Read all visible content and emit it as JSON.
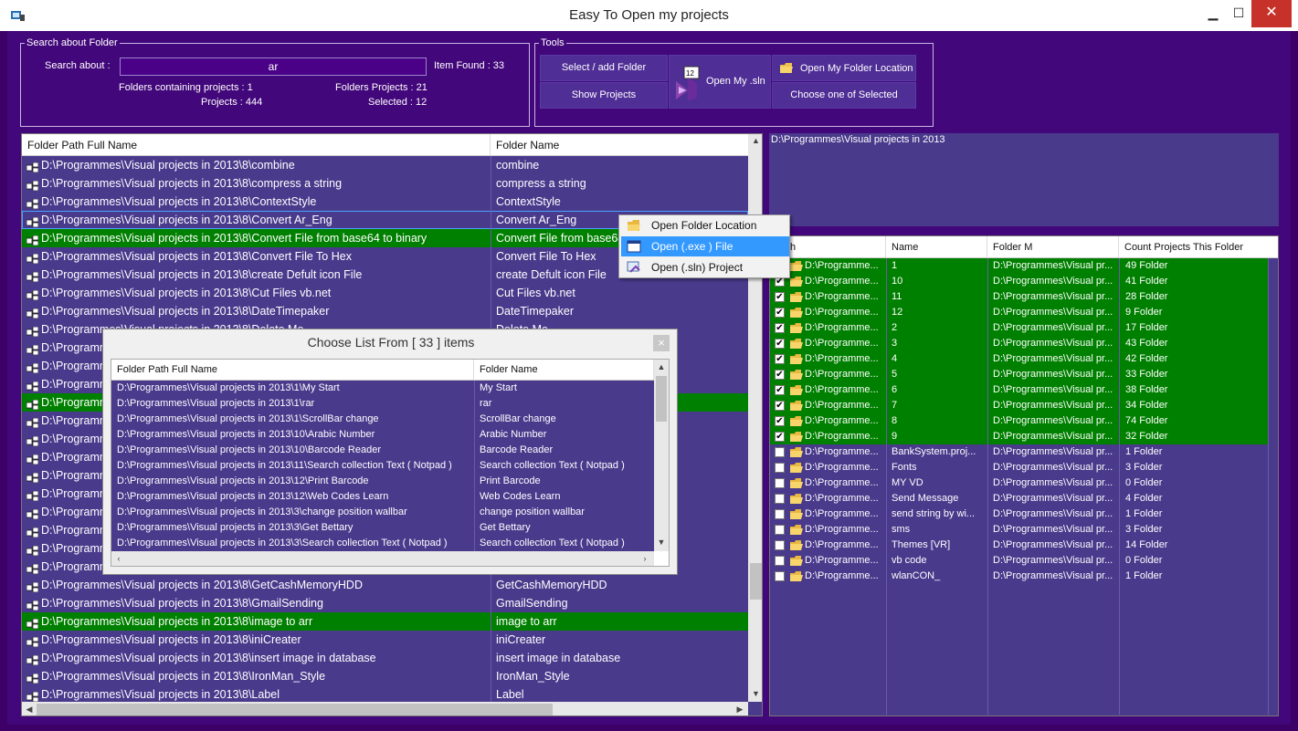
{
  "window": {
    "title": "Easy To Open my projects",
    "minimize": "▁",
    "maximize": "☐",
    "close": "✕"
  },
  "search": {
    "legend": "Search about Folder",
    "label": "Search about :",
    "value": "ar",
    "item_found": "Item Found : 33",
    "folders_containing": "Folders containing projects : 1",
    "folders_projects": "Folders Projects :  21",
    "projects": "Projects : 444",
    "selected": "Selected :  12"
  },
  "tools": {
    "legend": "Tools",
    "select_add": "Select / add Folder",
    "show_projects": "Show Projects",
    "open_sln": "Open My .sln",
    "open_folder_location": "Open My Folder Location",
    "choose_selected": "Choose one of Selected",
    "sln_badge": "12"
  },
  "main_grid": {
    "columns": [
      "Folder Path Full Name",
      "Folder Name"
    ],
    "rows": [
      {
        "path": "D:\\Programmes\\Visual projects in 2013\\8\\combine",
        "name": "combine",
        "state": "normal"
      },
      {
        "path": "D:\\Programmes\\Visual projects in 2013\\8\\compress a string",
        "name": "compress a string",
        "state": "normal"
      },
      {
        "path": "D:\\Programmes\\Visual projects in 2013\\8\\ContextStyle",
        "name": "ContextStyle",
        "state": "normal"
      },
      {
        "path": "D:\\Programmes\\Visual projects in 2013\\8\\Convert Ar_Eng",
        "name": "Convert Ar_Eng",
        "state": "selected"
      },
      {
        "path": "D:\\Programmes\\Visual projects in 2013\\8\\Convert File from base64 to binary",
        "name": "Convert File from base64 to binary",
        "state": "green"
      },
      {
        "path": "D:\\Programmes\\Visual projects in 2013\\8\\Convert File To Hex",
        "name": "Convert File To Hex",
        "state": "normal"
      },
      {
        "path": "D:\\Programmes\\Visual projects in 2013\\8\\create Defult icon File",
        "name": "create Defult icon File",
        "state": "normal"
      },
      {
        "path": "D:\\Programmes\\Visual projects in 2013\\8\\Cut Files vb.net",
        "name": "Cut Files vb.net",
        "state": "normal"
      },
      {
        "path": "D:\\Programmes\\Visual projects in 2013\\8\\DateTimepaker",
        "name": "DateTimepaker",
        "state": "normal"
      },
      {
        "path": "D:\\Programmes\\Visual projects in 2013\\8\\Delete Me",
        "name": "Delete Me",
        "state": "normal"
      },
      {
        "path": "D:\\Programmes",
        "name": "",
        "state": "normal"
      },
      {
        "path": "D:\\Programmes",
        "name": "",
        "state": "normal"
      },
      {
        "path": "D:\\Programmes",
        "name": "",
        "state": "normal"
      },
      {
        "path": "D:\\Programmes",
        "name": "",
        "state": "green"
      },
      {
        "path": "D:\\Programmes",
        "name": "",
        "state": "normal"
      },
      {
        "path": "D:\\Programmes",
        "name": "",
        "state": "normal"
      },
      {
        "path": "D:\\Programmes",
        "name": "",
        "state": "normal"
      },
      {
        "path": "D:\\Programmes",
        "name": "",
        "state": "normal"
      },
      {
        "path": "D:\\Programmes",
        "name": "",
        "state": "normal"
      },
      {
        "path": "D:\\Programmes",
        "name": "",
        "state": "normal"
      },
      {
        "path": "D:\\Programmes",
        "name": "",
        "state": "normal"
      },
      {
        "path": "D:\\Programmes",
        "name": "",
        "state": "normal"
      },
      {
        "path": "D:\\Programmes",
        "name": "",
        "state": "normal"
      },
      {
        "path": "D:\\Programmes\\Visual projects in 2013\\8\\GetCashMemoryHDD",
        "name": "GetCashMemoryHDD",
        "state": "normal"
      },
      {
        "path": "D:\\Programmes\\Visual projects in 2013\\8\\GmailSending",
        "name": "GmailSending",
        "state": "normal"
      },
      {
        "path": "D:\\Programmes\\Visual projects in 2013\\8\\image to arr",
        "name": "image to arr",
        "state": "green"
      },
      {
        "path": "D:\\Programmes\\Visual projects in 2013\\8\\iniCreater",
        "name": "iniCreater",
        "state": "normal"
      },
      {
        "path": "D:\\Programmes\\Visual projects in 2013\\8\\insert image in database",
        "name": "insert image in database",
        "state": "normal"
      },
      {
        "path": "D:\\Programmes\\Visual projects in 2013\\8\\IronMan_Style",
        "name": "IronMan_Style",
        "state": "normal"
      },
      {
        "path": "D:\\Programmes\\Visual projects in 2013\\8\\Label",
        "name": "Label",
        "state": "normal"
      }
    ]
  },
  "path_box": {
    "text": "D:\\Programmes\\Visual projects in 2013"
  },
  "right_grid": {
    "columns": [
      "h",
      "Name",
      "Folder M",
      "Count Projects This Folder"
    ],
    "rows": [
      {
        "checked": true,
        "path": "D:\\Programme...",
        "name": "1",
        "folder": "D:\\Programmes\\Visual pr...",
        "count": "49  Folder",
        "green": true
      },
      {
        "checked": true,
        "path": "D:\\Programme...",
        "name": "10",
        "folder": "D:\\Programmes\\Visual pr...",
        "count": "41  Folder",
        "green": true
      },
      {
        "checked": true,
        "path": "D:\\Programme...",
        "name": "11",
        "folder": "D:\\Programmes\\Visual pr...",
        "count": "28  Folder",
        "green": true
      },
      {
        "checked": true,
        "path": "D:\\Programme...",
        "name": "12",
        "folder": "D:\\Programmes\\Visual pr...",
        "count": "9  Folder",
        "green": true
      },
      {
        "checked": true,
        "path": "D:\\Programme...",
        "name": "2",
        "folder": "D:\\Programmes\\Visual pr...",
        "count": "17  Folder",
        "green": true
      },
      {
        "checked": true,
        "path": "D:\\Programme...",
        "name": "3",
        "folder": "D:\\Programmes\\Visual pr...",
        "count": "43  Folder",
        "green": true
      },
      {
        "checked": true,
        "path": "D:\\Programme...",
        "name": "4",
        "folder": "D:\\Programmes\\Visual pr...",
        "count": "42  Folder",
        "green": true
      },
      {
        "checked": true,
        "path": "D:\\Programme...",
        "name": "5",
        "folder": "D:\\Programmes\\Visual pr...",
        "count": "33  Folder",
        "green": true
      },
      {
        "checked": true,
        "path": "D:\\Programme...",
        "name": "6",
        "folder": "D:\\Programmes\\Visual pr...",
        "count": "38  Folder",
        "green": true
      },
      {
        "checked": true,
        "path": "D:\\Programme...",
        "name": "7",
        "folder": "D:\\Programmes\\Visual pr...",
        "count": "34  Folder",
        "green": true
      },
      {
        "checked": true,
        "path": "D:\\Programme...",
        "name": "8",
        "folder": "D:\\Programmes\\Visual pr...",
        "count": "74  Folder",
        "green": true
      },
      {
        "checked": true,
        "path": "D:\\Programme...",
        "name": "9",
        "folder": "D:\\Programmes\\Visual pr...",
        "count": "32  Folder",
        "green": true
      },
      {
        "checked": false,
        "path": "D:\\Programme...",
        "name": "BankSystem.proj...",
        "folder": "D:\\Programmes\\Visual pr...",
        "count": "1  Folder",
        "green": false
      },
      {
        "checked": false,
        "path": "D:\\Programme...",
        "name": "Fonts",
        "folder": "D:\\Programmes\\Visual pr...",
        "count": "3  Folder",
        "green": false
      },
      {
        "checked": false,
        "path": "D:\\Programme...",
        "name": "MY VD",
        "folder": "D:\\Programmes\\Visual pr...",
        "count": "0  Folder",
        "green": false
      },
      {
        "checked": false,
        "path": "D:\\Programme...",
        "name": "Send Message",
        "folder": "D:\\Programmes\\Visual pr...",
        "count": "4  Folder",
        "green": false
      },
      {
        "checked": false,
        "path": "D:\\Programme...",
        "name": "send string by wi...",
        "folder": "D:\\Programmes\\Visual pr...",
        "count": "1  Folder",
        "green": false
      },
      {
        "checked": false,
        "path": "D:\\Programme...",
        "name": "sms",
        "folder": "D:\\Programmes\\Visual pr...",
        "count": "3  Folder",
        "green": false
      },
      {
        "checked": false,
        "path": "D:\\Programme...",
        "name": "Themes [VR]",
        "folder": "D:\\Programmes\\Visual pr...",
        "count": "14  Folder",
        "green": false
      },
      {
        "checked": false,
        "path": "D:\\Programme...",
        "name": "vb code",
        "folder": "D:\\Programmes\\Visual pr...",
        "count": "0  Folder",
        "green": false
      },
      {
        "checked": false,
        "path": "D:\\Programme...",
        "name": "wlanCON_",
        "folder": "D:\\Programmes\\Visual pr...",
        "count": "1  Folder",
        "green": false
      }
    ]
  },
  "context_menu": {
    "items": [
      {
        "label": "Open Folder Location",
        "icon": "folder-icon",
        "highlighted": false
      },
      {
        "label": "Open (.exe ) File",
        "icon": "exe-window-icon",
        "highlighted": true
      },
      {
        "label": "Open (.sln) Project",
        "icon": "sln-project-icon",
        "highlighted": false
      }
    ]
  },
  "dialog": {
    "title": "Choose List From [ 33 ] items",
    "close": "×",
    "columns": [
      "Folder Path Full Name",
      "Folder Name"
    ],
    "rows": [
      {
        "path": "D:\\Programmes\\Visual projects in 2013\\1\\My Start",
        "name": "My Start"
      },
      {
        "path": "D:\\Programmes\\Visual projects in 2013\\1\\rar",
        "name": "rar"
      },
      {
        "path": "D:\\Programmes\\Visual projects in 2013\\1\\ScrollBar change",
        "name": "ScrollBar change"
      },
      {
        "path": "D:\\Programmes\\Visual projects in 2013\\10\\Arabic Number",
        "name": "Arabic Number"
      },
      {
        "path": "D:\\Programmes\\Visual projects in 2013\\10\\Barcode Reader",
        "name": "Barcode Reader"
      },
      {
        "path": "D:\\Programmes\\Visual projects in 2013\\11\\Search collection Text ( Notpad )",
        "name": "Search collection Text ( Notpad )"
      },
      {
        "path": "D:\\Programmes\\Visual projects in 2013\\12\\Print Barcode",
        "name": "Print Barcode"
      },
      {
        "path": "D:\\Programmes\\Visual projects in 2013\\12\\Web Codes Learn",
        "name": "Web Codes Learn"
      },
      {
        "path": "D:\\Programmes\\Visual projects in 2013\\3\\change position wallbar",
        "name": "change position wallbar"
      },
      {
        "path": "D:\\Programmes\\Visual projects in 2013\\3\\Get Bettary",
        "name": "Get Bettary"
      },
      {
        "path": "D:\\Programmes\\Visual projects in 2013\\3\\Search collection Text ( Notpad )",
        "name": "Search collection Text ( Notpad )"
      }
    ]
  },
  "colors": {
    "window_bg": "#42077a",
    "grid_bg": "#4a3a8c",
    "highlight_green": "#008000",
    "menu_highlight": "#3399ff"
  }
}
